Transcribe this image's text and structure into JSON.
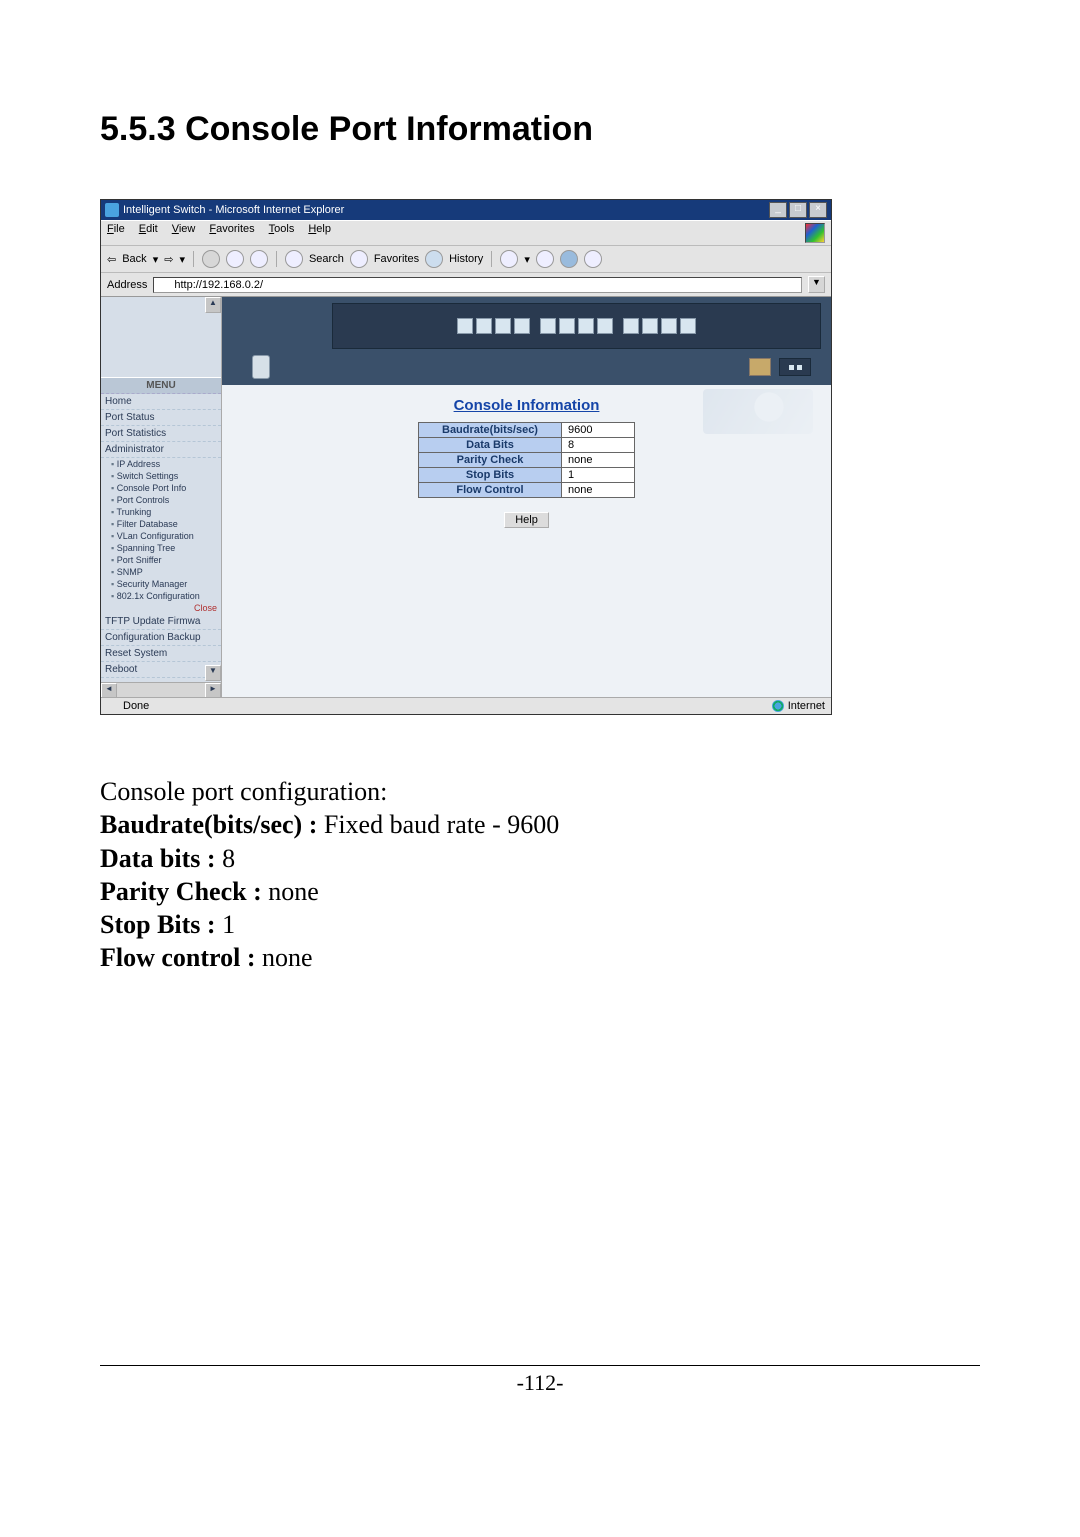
{
  "doc": {
    "section_heading": "5.5.3 Console Port Information",
    "page_number": "-112-"
  },
  "browser": {
    "window_title": "Intelligent Switch - Microsoft Internet Explorer",
    "menus": [
      "File",
      "Edit",
      "View",
      "Favorites",
      "Tools",
      "Help"
    ],
    "toolbar": {
      "back": "Back",
      "search": "Search",
      "favorites": "Favorites",
      "history": "History"
    },
    "address_label": "Address",
    "url": "http://192.168.0.2/",
    "status_done": "Done",
    "status_zone": "Internet"
  },
  "sidebar": {
    "menu_label": "MENU",
    "items_top": [
      "Home",
      "Port Status",
      "Port Statistics",
      "Administrator"
    ],
    "items_sub": [
      "IP Address",
      "Switch Settings",
      "Console Port Info",
      "Port Controls",
      "Trunking",
      "Filter Database",
      "VLan Configuration",
      "Spanning Tree",
      "Port Sniffer",
      "SNMP",
      "Security Manager",
      "802.1x Configuration"
    ],
    "close": "Close",
    "items_bottom": [
      "TFTP Update Firmwa",
      "Configuration Backup",
      "Reset System",
      "Reboot"
    ]
  },
  "console": {
    "title": "Console Information",
    "rows": [
      {
        "label": "Baudrate(bits/sec)",
        "value": "9600"
      },
      {
        "label": "Data Bits",
        "value": "8"
      },
      {
        "label": "Parity Check",
        "value": "none"
      },
      {
        "label": "Stop Bits",
        "value": "1"
      },
      {
        "label": "Flow Control",
        "value": "none"
      }
    ],
    "help": "Help"
  },
  "body": {
    "intro": "Console port configuration:",
    "lines": [
      {
        "k": "Baudrate(bits/sec) : ",
        "v": "Fixed baud rate - 9600"
      },
      {
        "k": "Data bits : ",
        "v": "8"
      },
      {
        "k": "Parity Check : ",
        "v": "none"
      },
      {
        "k": "Stop Bits : ",
        "v": "1"
      },
      {
        "k": "Flow control : ",
        "v": "none"
      }
    ]
  }
}
